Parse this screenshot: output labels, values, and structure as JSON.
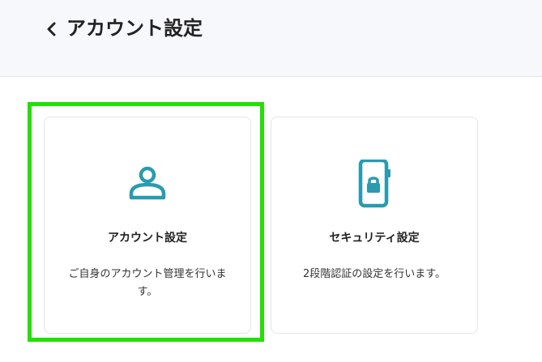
{
  "header": {
    "back_icon": "chevron-left-icon",
    "title": "アカウント設定"
  },
  "cards": [
    {
      "icon": "person-icon",
      "title": "アカウント設定",
      "description": "ご自身のアカウント管理を行います。",
      "highlighted": true
    },
    {
      "icon": "smartphone-lock-icon",
      "title": "セキュリティ設定",
      "description": "2段階認証の設定を行います。",
      "highlighted": false
    }
  ],
  "colors": {
    "icon_accent": "#2a9ab0",
    "highlight_border": "#22e000",
    "header_bg": "#f6f8fb"
  }
}
